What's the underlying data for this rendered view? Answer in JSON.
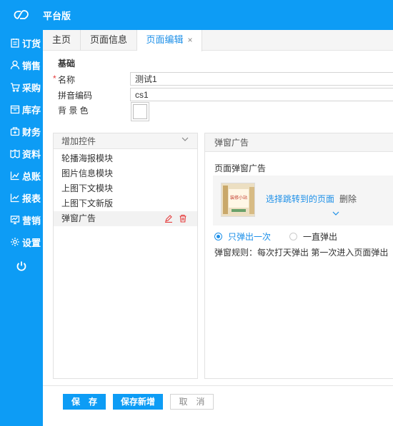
{
  "app": {
    "brand": "平台版",
    "logo_icon": "cloud-logo-icon"
  },
  "sidebar": {
    "items": [
      {
        "label": "订货",
        "icon": "order-icon"
      },
      {
        "label": "销售",
        "icon": "user-icon"
      },
      {
        "label": "采购",
        "icon": "cart-icon"
      },
      {
        "label": "库存",
        "icon": "inventory-icon"
      },
      {
        "label": "财务",
        "icon": "finance-icon"
      },
      {
        "label": "资料",
        "icon": "data-icon"
      },
      {
        "label": "总账",
        "icon": "ledger-icon"
      },
      {
        "label": "报表",
        "icon": "report-icon"
      },
      {
        "label": "营销",
        "icon": "marketing-icon"
      },
      {
        "label": "设置",
        "icon": "settings-icon"
      }
    ],
    "power_icon": "power-icon"
  },
  "tabs": [
    {
      "label": "主页",
      "active": false
    },
    {
      "label": "页面信息",
      "active": false
    },
    {
      "label": "页面编辑",
      "active": true,
      "close": "×"
    }
  ],
  "form": {
    "section_title": "基础",
    "required_mark": "*",
    "name_label": "名称",
    "name_value": "测试1",
    "pinyin_label": "拼音编码",
    "pinyin_value": "cs1",
    "bg_label": "背 景 色"
  },
  "controls_panel": {
    "header": "增加控件",
    "items": [
      "轮播海报模块",
      "图片信息模块",
      "上图下文模块",
      "上图下文新版",
      "弹窗广告"
    ],
    "selected_index": 4
  },
  "ad_panel": {
    "header": "弹窗广告",
    "label": "页面弹窗广告",
    "thumb_text": "装修小站",
    "link_text": "选择跳转到的页面",
    "delete_text": "删除",
    "radio_once": "只弹出一次",
    "radio_always": "一直弹出",
    "rule_text": "弹窗规则：每次打天弹出 第一次进入页面弹出"
  },
  "footer": {
    "save": "保　存",
    "save_new": "保存新增",
    "cancel": "取　消"
  },
  "colors": {
    "primary": "#0d9cf5",
    "link": "#1c8fe8",
    "danger": "#e53b3b"
  }
}
